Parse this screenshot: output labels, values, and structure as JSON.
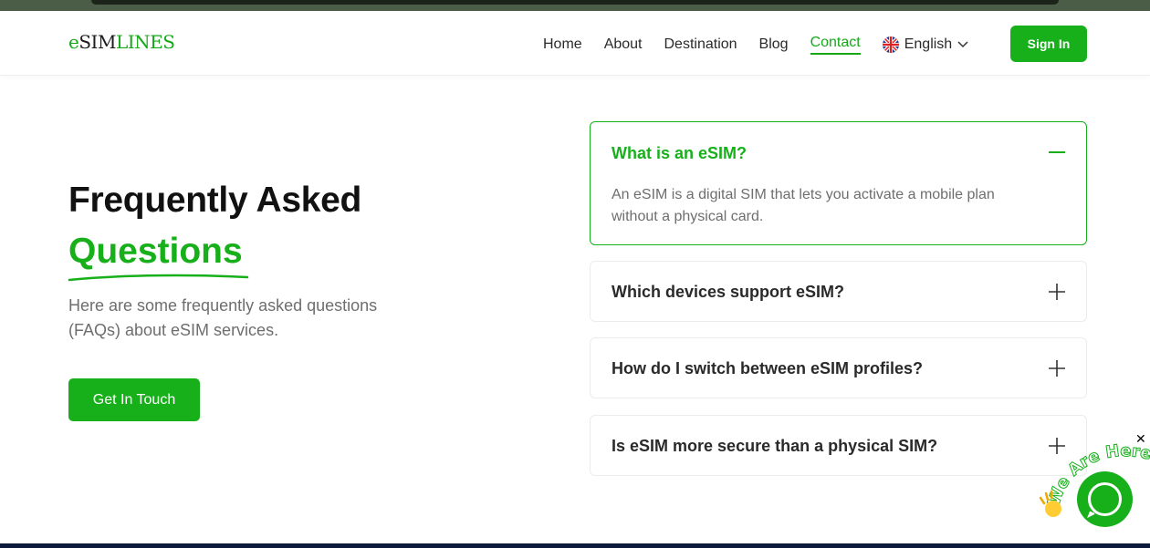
{
  "brand": {
    "logo_e": "e",
    "logo_sim": "SIM",
    "logo_lines": "LINES"
  },
  "nav": {
    "items": [
      {
        "label": "Home"
      },
      {
        "label": "About"
      },
      {
        "label": "Destination"
      },
      {
        "label": "Blog"
      },
      {
        "label": "Contact",
        "active": true
      }
    ],
    "language": "English",
    "signin_label": "Sign In"
  },
  "hero": {
    "title_line1": "Frequently Asked",
    "title_line2": "Questions",
    "subtitle": "Here are some frequently asked questions (FAQs) about eSIM services.",
    "cta_label": "Get In Touch"
  },
  "faq": [
    {
      "question": "What is an eSIM?",
      "answer": "An eSIM is a digital SIM that lets you activate a mobile plan without a physical card.",
      "expanded": true
    },
    {
      "question": "Which devices support eSIM?",
      "expanded": false
    },
    {
      "question": "How do I switch between eSIM profiles?",
      "expanded": false
    },
    {
      "question": "Is eSIM more secure than a physical SIM?",
      "expanded": false
    }
  ],
  "chat_widget": {
    "badge_text": "We Are Here!",
    "close_symbol": "✕"
  },
  "colors": {
    "accent": "#17b01b",
    "text": "#1d1d1f",
    "muted": "#6e6e6e"
  },
  "icons": {
    "flag": "uk-flag-icon",
    "lang_chevron": "chevron-down-icon",
    "collapse": "minus-icon",
    "expand": "plus-icon",
    "chat": "chat-bubble-icon",
    "close": "close-icon"
  }
}
